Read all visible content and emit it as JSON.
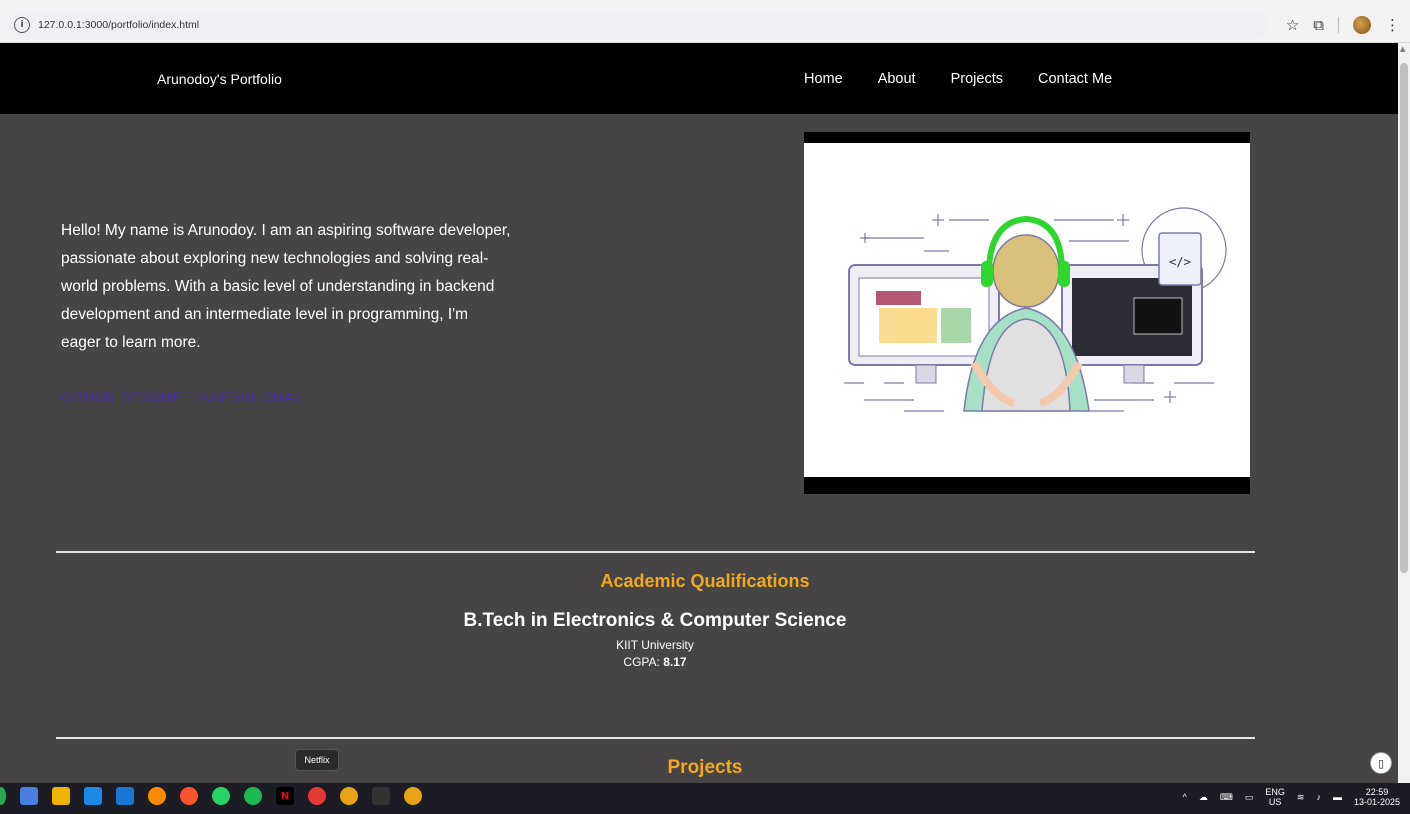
{
  "browser": {
    "url": "127.0.0.1:3000/portfolio/index.html",
    "info_icon": "info-icon",
    "icons": [
      "star-icon",
      "extensions-icon",
      "profile-avatar",
      "menu-icon"
    ]
  },
  "navbar": {
    "brand": "Arunodoy's Portfolio",
    "links": [
      "Home",
      "About",
      "Projects",
      "Contact Me"
    ]
  },
  "hero": {
    "intro": "Hello! My name is Arunodoy. I am an aspiring software developer, passionate about exploring new technologies and solving real-world problems. With a basic level of understanding in backend development and an intermediate level in programming, I'm eager to learn more.",
    "links": [
      "GITHUB",
      "RESUME",
      "LINKEDIN",
      "GMAIL"
    ]
  },
  "academic": {
    "title": "Academic Qualifications",
    "degree": "B.Tech in Electronics & Computer Science",
    "university": "KIIT University",
    "cgpa_label": "CGPA:",
    "cgpa_value": "8.17"
  },
  "projects": {
    "title": "Projects"
  },
  "tooltip": "Netflix",
  "taskbar": {
    "tray": {
      "lang_top": "ENG",
      "lang_bottom": "US",
      "time": "22:59",
      "date": "13-01-2025"
    }
  },
  "colors": {
    "background": "#464444",
    "navbar": "#000000",
    "accent": "#f2a81c",
    "link": "#4b2ea8"
  }
}
